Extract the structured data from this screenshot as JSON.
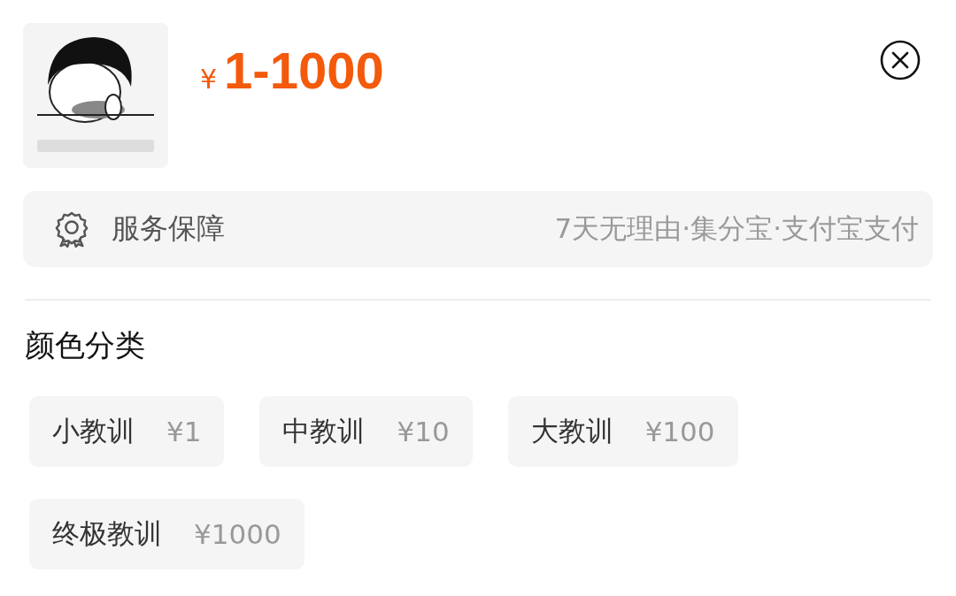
{
  "product": {
    "currency": "¥",
    "price_range": "1-1000"
  },
  "service": {
    "label": "服务保障",
    "details": "7天无理由·集分宝·支付宝支付"
  },
  "options_section": {
    "title": "颜色分类",
    "options": [
      {
        "label": "小教训",
        "price": "¥1",
        "selected": false
      },
      {
        "label": "中教训",
        "price": "¥10",
        "selected": false
      },
      {
        "label": "大教训",
        "price": "¥100",
        "selected": false
      },
      {
        "label": "终极教训",
        "price": "¥1000",
        "selected": false
      }
    ]
  }
}
